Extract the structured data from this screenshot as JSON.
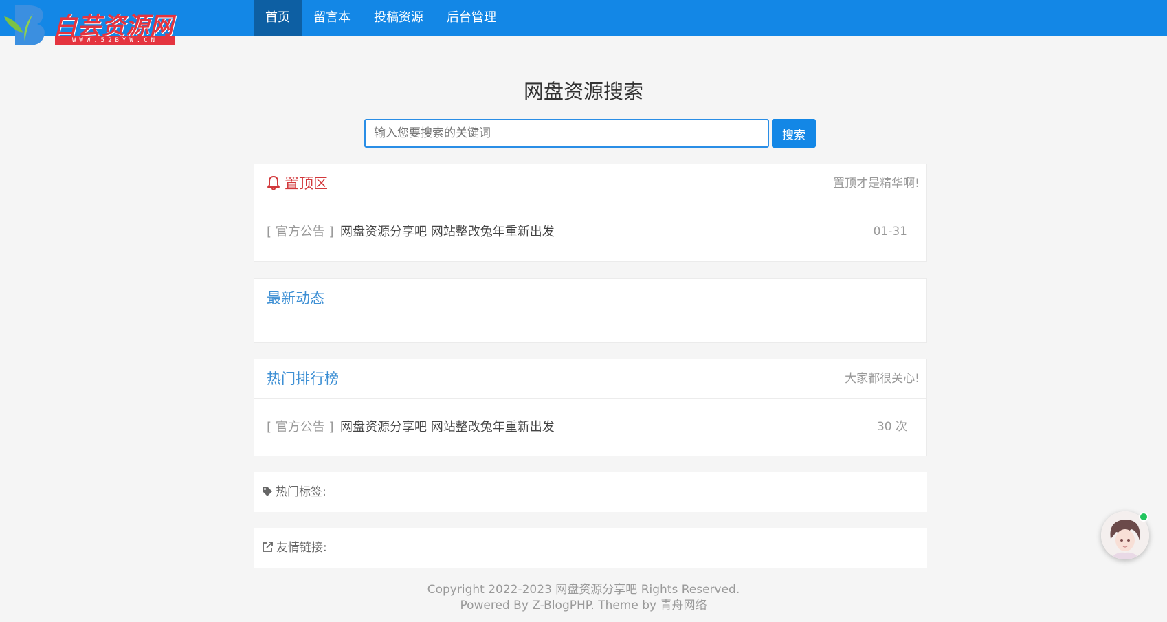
{
  "logo": {
    "text": "白芸资源网",
    "sub": "WWW.52BYW.CN"
  },
  "nav": {
    "items": [
      {
        "label": "首页"
      },
      {
        "label": "留言本"
      },
      {
        "label": "投稿资源"
      },
      {
        "label": "后台管理"
      }
    ]
  },
  "search": {
    "title": "网盘资源搜索",
    "placeholder": "输入您要搜索的关键词",
    "button": "搜索"
  },
  "pinned": {
    "title": "置顶区",
    "note": "置顶才是精华啊!",
    "items": [
      {
        "tag": "[ 官方公告 ]",
        "title": "网盘资源分享吧 网站整改兔年重新出发",
        "date": "01-31"
      }
    ]
  },
  "latest": {
    "title": "最新动态"
  },
  "hot": {
    "title": "热门排行榜",
    "note": "大家都很关心!",
    "items": [
      {
        "tag": "[ 官方公告 ]",
        "title": "网盘资源分享吧 网站整改兔年重新出发",
        "views": "30 次"
      }
    ]
  },
  "tags": {
    "label": "热门标签:"
  },
  "links": {
    "label": "友情链接:"
  },
  "footer": {
    "copyright": "Copyright 2022-2023 网盘资源分享吧 Rights Reserved.",
    "powered": "Powered By Z-BlogPHP. Theme by 青舟网络"
  },
  "colors": {
    "nav_bg": "#1387e6",
    "nav_active": "#0d5fa3",
    "panel_title": "#3d8fd4",
    "pinned_title": "#d2383b",
    "logo_red": "#e4343f",
    "online": "#22c55e"
  },
  "icons": {
    "pinned": "bell-icon",
    "tags": "tag-icon",
    "links": "external-link-icon"
  }
}
